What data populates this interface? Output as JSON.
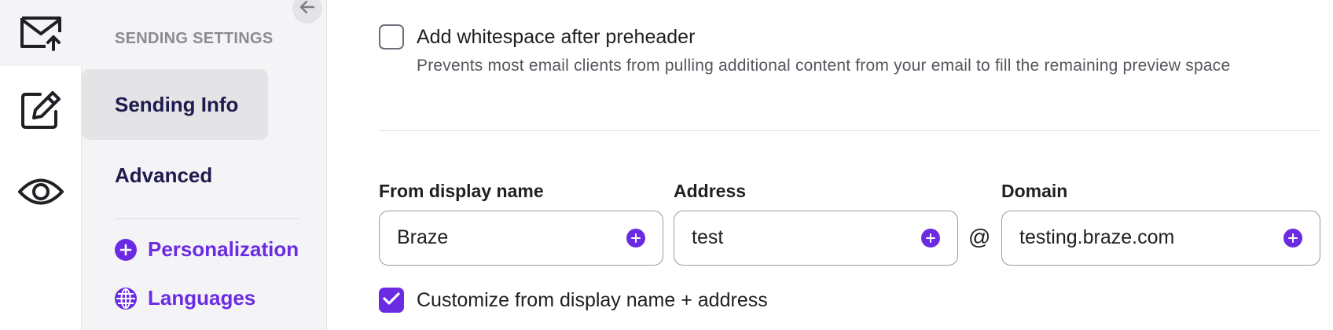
{
  "rail": {
    "items": [
      {
        "icon": "mail-send-icon"
      },
      {
        "icon": "edit-icon"
      },
      {
        "icon": "eye-icon"
      }
    ]
  },
  "sidebar": {
    "collapse_icon": "arrow-left-icon",
    "heading": "SENDING SETTINGS",
    "items": [
      {
        "label": "Sending Info",
        "selected": true
      },
      {
        "label": "Advanced",
        "selected": false
      }
    ],
    "links": [
      {
        "label": "Personalization",
        "icon": "plus-circle-icon"
      },
      {
        "label": "Languages",
        "icon": "globe-icon"
      }
    ]
  },
  "main": {
    "whitespace_option": {
      "label": "Add whitespace after preheader",
      "help": "Prevents most email clients from pulling additional content from your email to fill the remaining preview space",
      "checked": false
    },
    "from_display_name": {
      "label": "From display name",
      "value": "Braze"
    },
    "address": {
      "label": "Address",
      "value": "test"
    },
    "at": "@",
    "domain": {
      "label": "Domain",
      "value": "testing.braze.com"
    },
    "customize_option": {
      "label": "Customize from display name + address",
      "checked": true
    }
  },
  "colors": {
    "accent": "#6a2be3",
    "nav_text": "#1e1a4e",
    "sidebar_bg": "#f4f4f6"
  }
}
